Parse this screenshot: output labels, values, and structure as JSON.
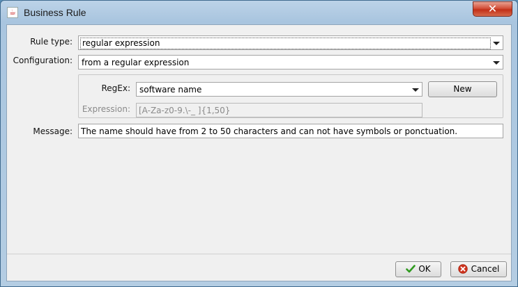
{
  "window": {
    "title": "Business Rule",
    "close_symbol": "✕"
  },
  "form": {
    "rule_type_label": "Rule type:",
    "rule_type_value": "regular expression",
    "configuration_label": "Configuration:",
    "configuration_value": "from a regular expression",
    "regex_label": "RegEx:",
    "regex_value": "software name",
    "new_button_label": "New",
    "expression_label": "Expression:",
    "expression_value": "[A-Za-z0-9.\\-_ ]{1,50}",
    "message_label": "Message:",
    "message_value": "The name should have from 2 to 50 characters and can not have symbols or ponctuation."
  },
  "footer": {
    "ok_label": "OK",
    "cancel_label": "Cancel"
  },
  "colors": {
    "ok_check": "#2f9a1f",
    "cancel_icon": "#d0331e"
  }
}
